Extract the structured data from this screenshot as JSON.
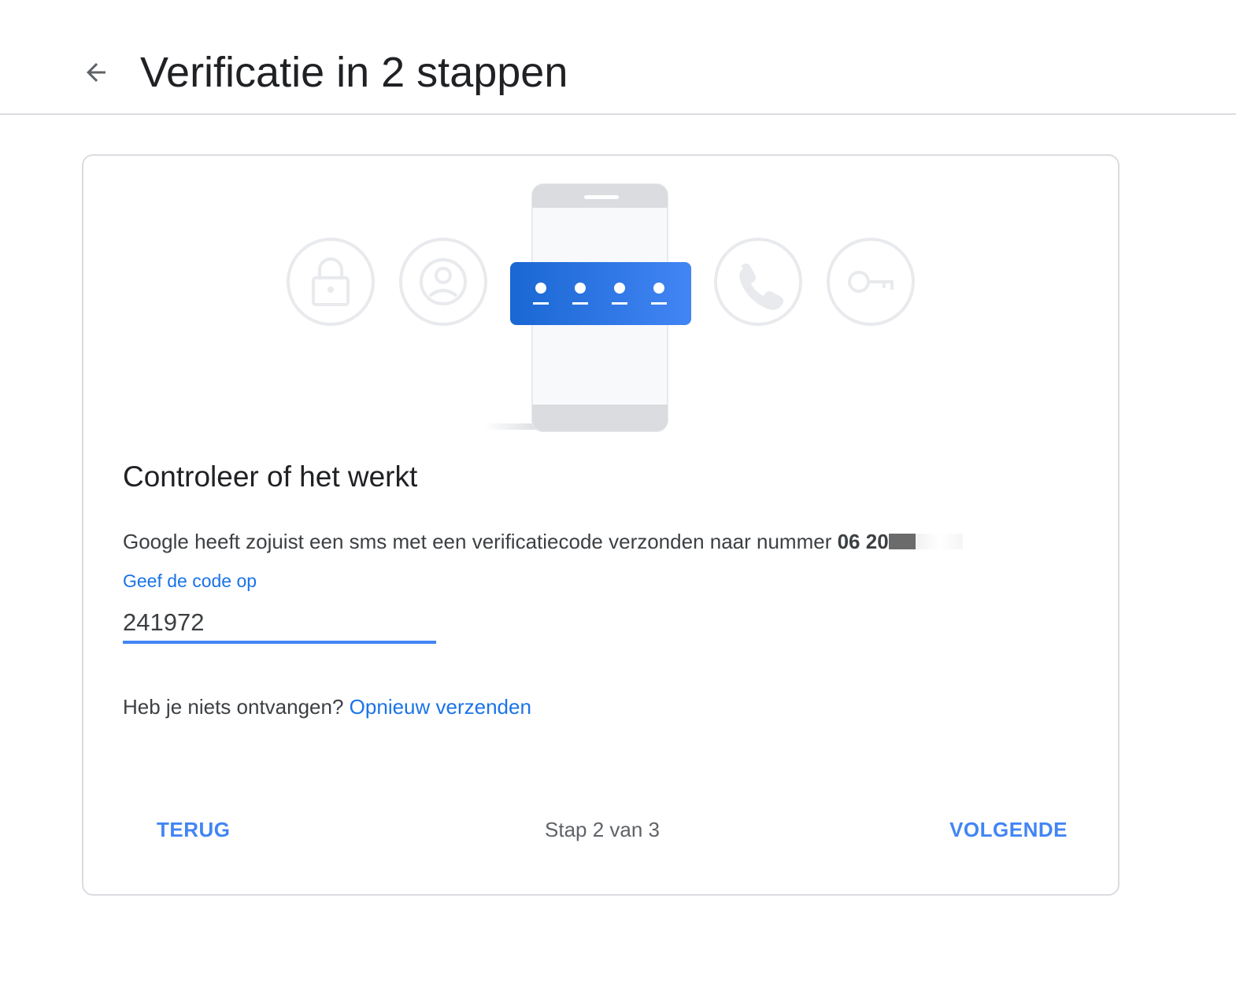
{
  "header": {
    "title": "Verificatie in 2 stappen",
    "back_icon": "arrow-back-icon"
  },
  "illustration": {
    "icons": [
      "lock-icon",
      "account-circle-icon",
      "phone-icon",
      "key-icon"
    ],
    "code_dots": 4,
    "accent_color": "#1a73e8"
  },
  "card": {
    "title": "Controleer of het werkt",
    "description": "Google heeft zojuist een sms met een verificatiecode verzonden naar nummer ",
    "phone_number_visible": "06 20",
    "code_label": "Geef de code op",
    "code_value": "241972",
    "resend_prompt": "Heb je niets ontvangen?",
    "resend_link": "Opnieuw verzenden"
  },
  "footer": {
    "back_label": "TERUG",
    "step_text": "Stap 2 van 3",
    "next_label": "VOLGENDE"
  },
  "colors": {
    "link": "#1a73e8",
    "button": "#4285f4",
    "border": "#dadce0"
  }
}
